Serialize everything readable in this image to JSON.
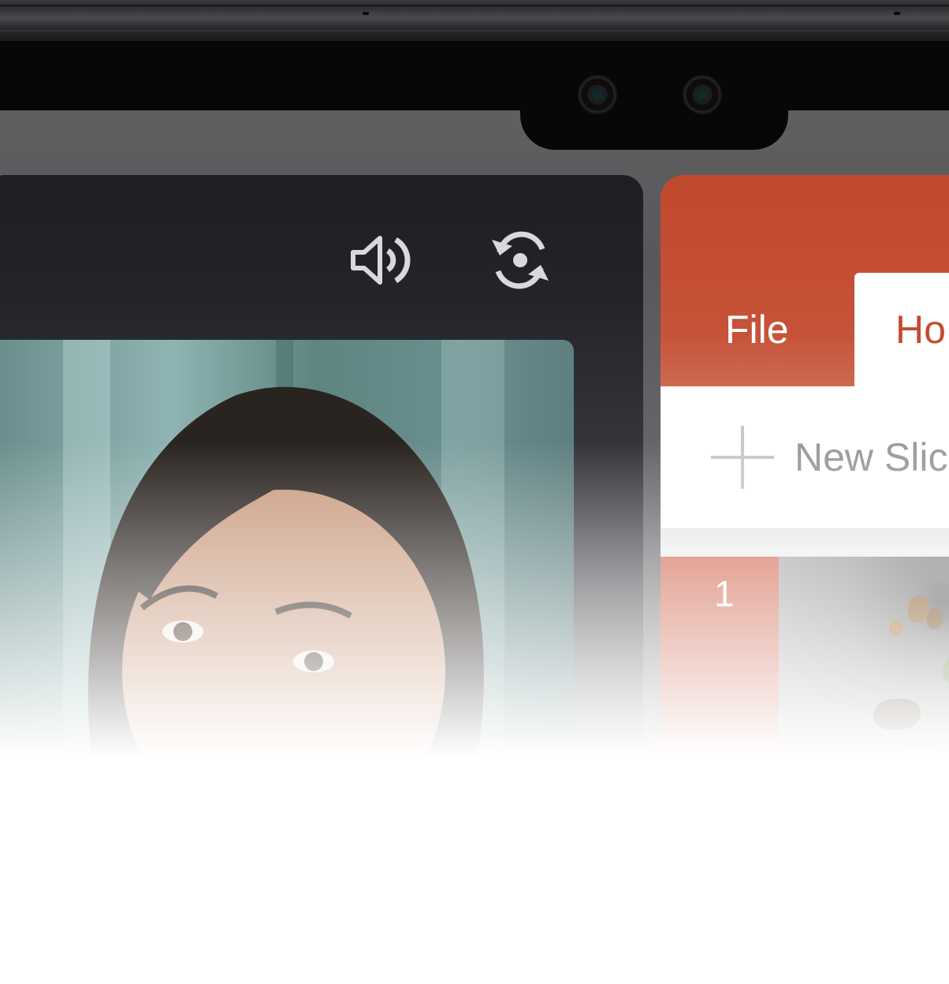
{
  "device": {
    "camera_count": 2
  },
  "call_pane": {
    "speaker_icon": "speaker-volume-icon",
    "switch_camera_icon": "switch-camera-icon"
  },
  "ppt": {
    "accent": "#c44c2f",
    "tabs": [
      {
        "label": "File"
      },
      {
        "label": "Ho"
      }
    ],
    "ribbon": {
      "new_slide_label": "New Slic"
    },
    "slides": [
      {
        "number": "1"
      }
    ]
  }
}
